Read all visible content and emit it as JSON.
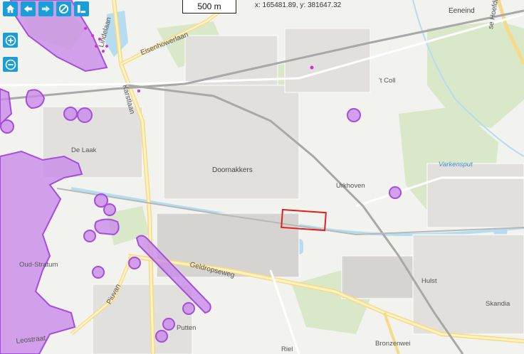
{
  "toolbar": {
    "buttons": [
      {
        "name": "home-button",
        "icon": "home-icon"
      },
      {
        "name": "back-button",
        "icon": "arrow-left-icon"
      },
      {
        "name": "forward-button",
        "icon": "arrow-right-icon"
      },
      {
        "name": "no-layers-button",
        "icon": "prohibited-icon"
      },
      {
        "name": "layers-panel-button",
        "icon": "panel-icon"
      }
    ],
    "zoom_in_icon": "plus-circle-icon",
    "zoom_out_icon": "minus-circle-icon",
    "accent_color": "#1a9ed8"
  },
  "scale": {
    "label": "500 m"
  },
  "coordinates": {
    "text": "x: 165481.89, y: 381647.32"
  },
  "labels": {
    "eeneind": "Eeneind",
    "hoefdijk": "se Hoefdijk",
    "eisenhowerlaan": "Eisenhowerlaan",
    "lindelaan": "Lindelaan",
    "karstlaan": "Karstlaan",
    "t_coll": "'t Coll",
    "de_laak": "De Laak",
    "doornakkers": "Doornakkers",
    "urkhoven": "Urkhoven",
    "varkensput": "Varkensput",
    "oud_stratum": "Oud-Stratum",
    "geldropseweg": "Geldropseweg",
    "piuvan": "Piuvan",
    "hulst": "Hulst",
    "skandia": "Skandia",
    "putten": "Putten",
    "leostraat": "Leostraat",
    "bronzenwei": "Bronzenwei",
    "riel": "Riel"
  },
  "colors": {
    "overlay_fill": "#c98be8",
    "overlay_stroke": "#a64ddb",
    "selection": "#e01f1f",
    "water": "#b6dcf0",
    "green": "#d7e8c6"
  }
}
